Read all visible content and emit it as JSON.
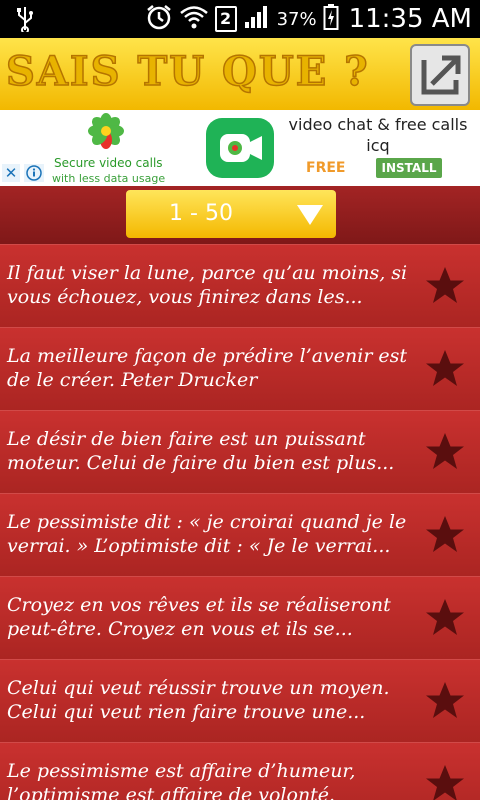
{
  "status_bar": {
    "battery_percent": "37%",
    "sim_slot": "2",
    "time": "11:35 AM"
  },
  "header": {
    "app_title": "SAIS TU QUE ?"
  },
  "ad": {
    "caption_line1": "Secure video calls",
    "caption_line2": "with less data usage",
    "title": "video chat & free calls icq",
    "price": "FREE",
    "install_label": "INSTALL",
    "close_glyph": "✕"
  },
  "toolbar": {
    "range_label": "1 - 50"
  },
  "quotes": [
    {
      "text": "Il faut viser la lune, parce qu’au moins, si vous échouez, vous finirez dans les..."
    },
    {
      "text": "La meilleure façon de prédire l’avenir est de le créer. Peter Drucker"
    },
    {
      "text": "Le désir de bien faire est un puissant moteur. Celui de faire du bien est plus..."
    },
    {
      "text": "Le pessimiste dit : « je croirai quand je le verrai. » L’optimiste dit : « Je le verrai..."
    },
    {
      "text": "Croyez en vos rêves et ils se réaliseront peut-être. Croyez en vous et ils se..."
    },
    {
      "text": "Celui qui veut réussir trouve un moyen. Celui qui veut rien faire trouve une..."
    },
    {
      "text": "Le pessimisme est affaire d’humeur, l’optimisme est affaire de volonté. Emile..."
    }
  ],
  "colors": {
    "header_yellow": "#f2b800",
    "row_red": "#b92a27",
    "star_dark": "#5a0e0e"
  },
  "icons": [
    "usb-icon",
    "alarm-icon",
    "wifi-icon",
    "signal-icon",
    "battery-icon",
    "share-icon",
    "icq-flower-icon",
    "video-call-icon",
    "dropdown-arrow-icon",
    "star-icon"
  ]
}
